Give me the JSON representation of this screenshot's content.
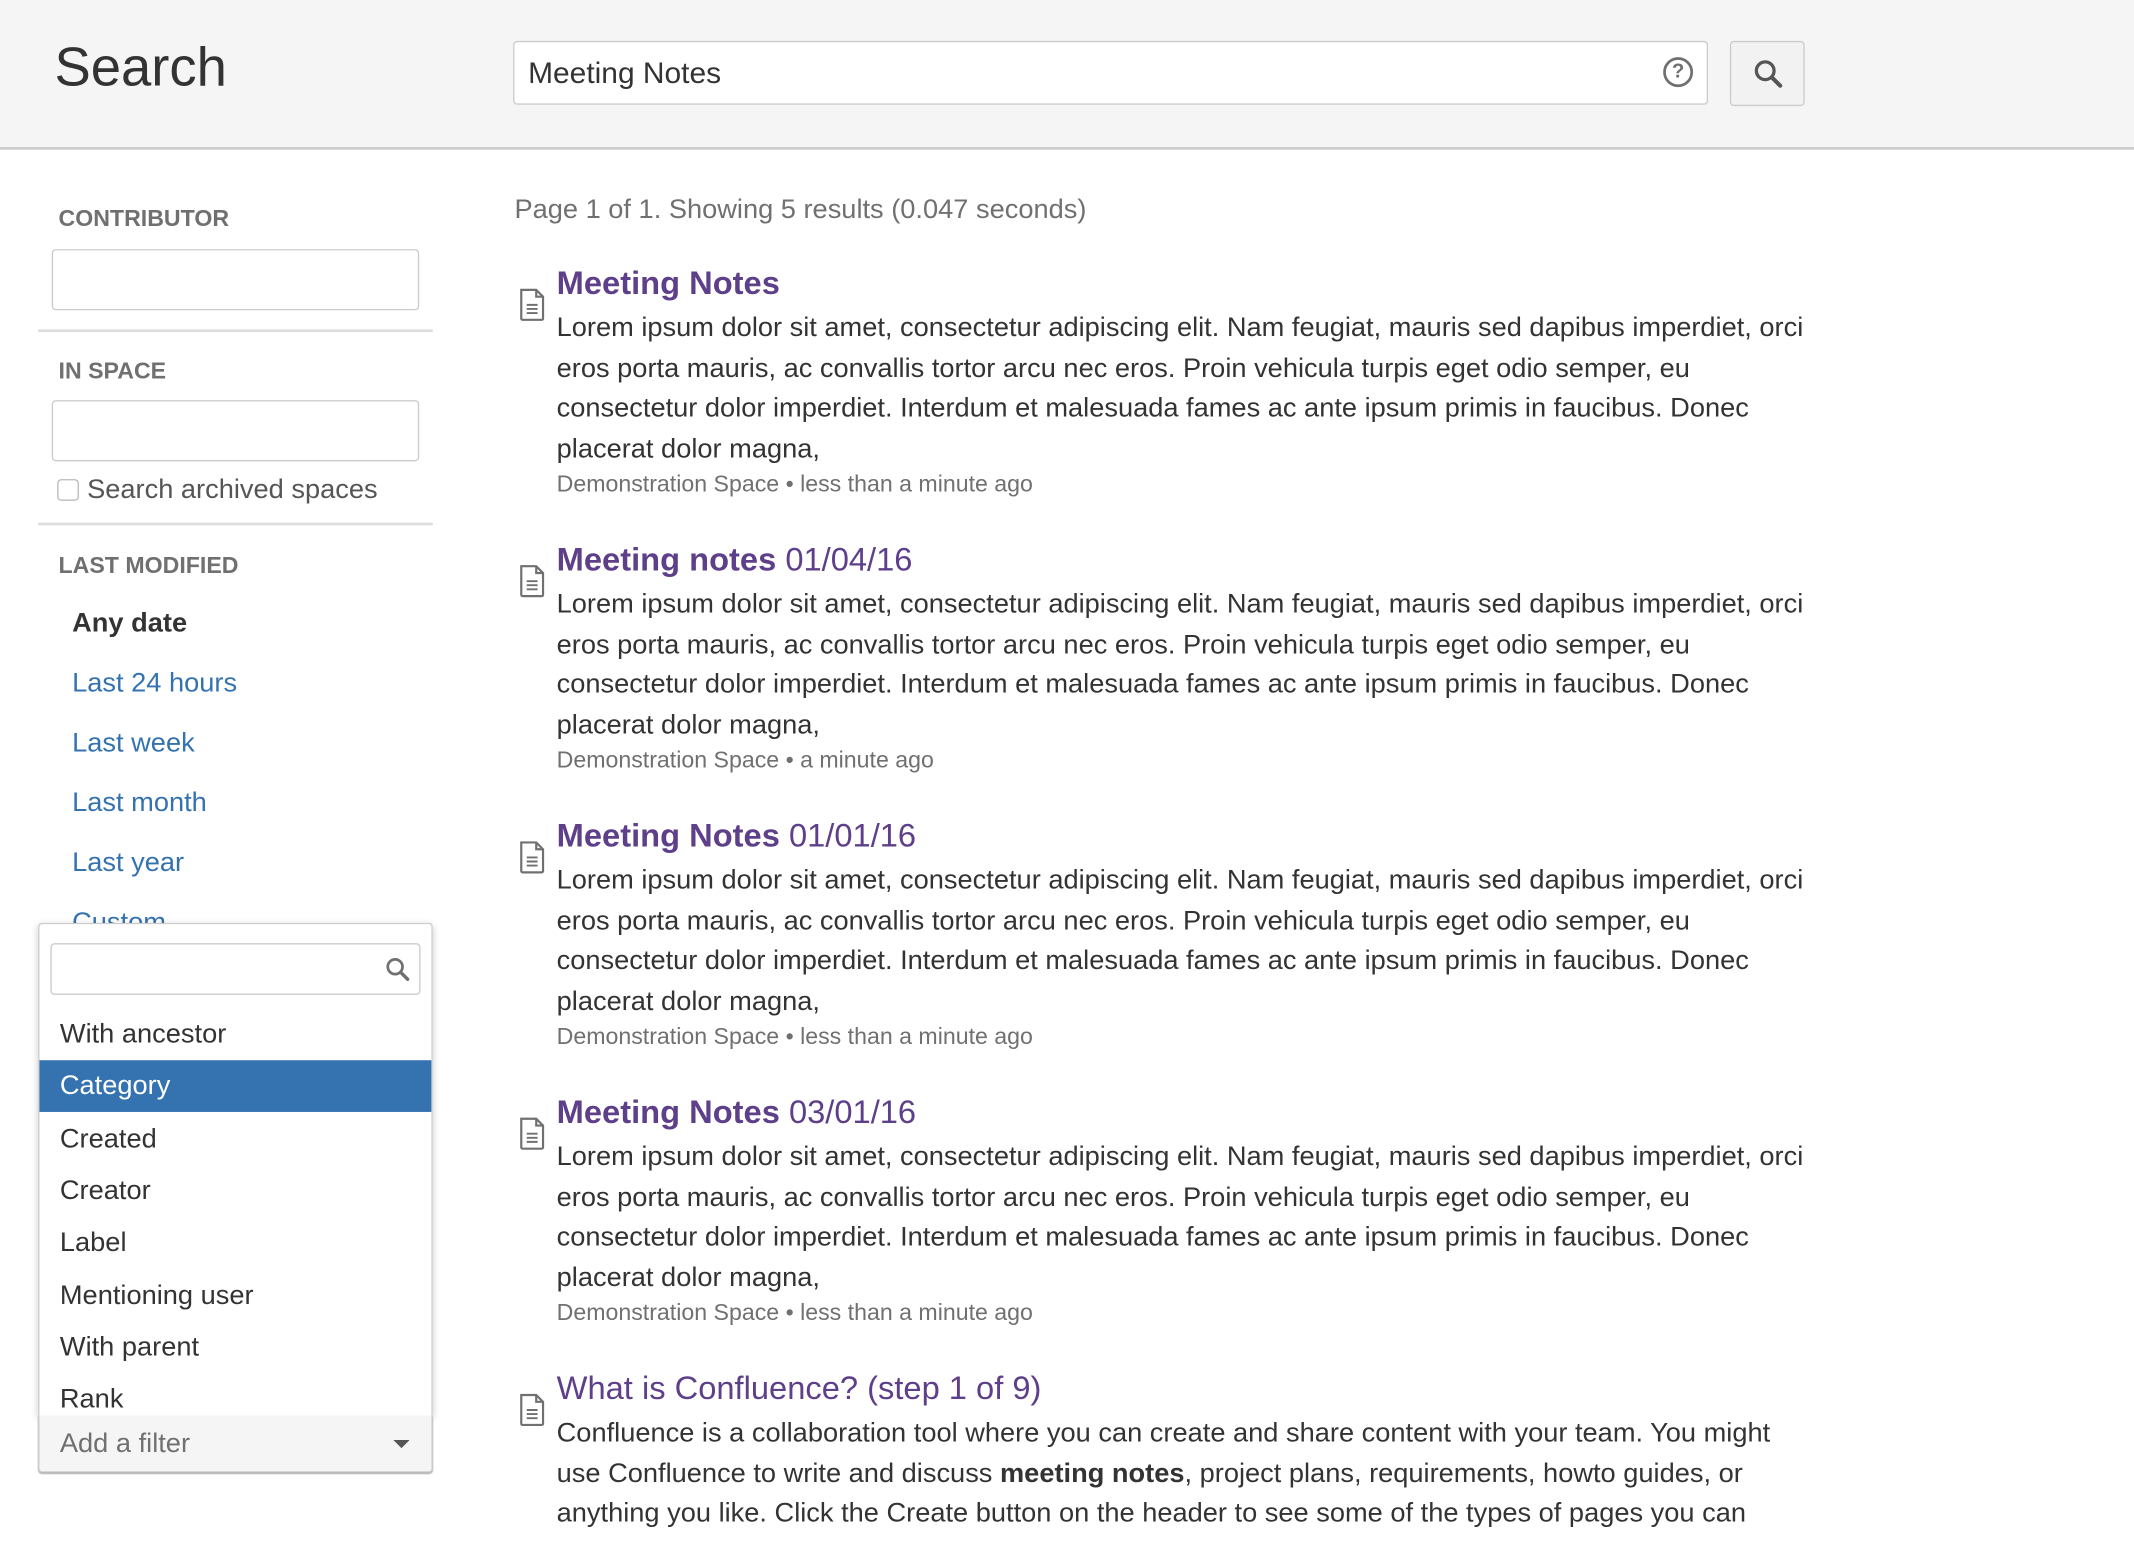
{
  "header": {
    "title": "Search",
    "query": "Meeting Notes",
    "help_icon": "question-circle-icon",
    "search_icon": "magnifier-icon"
  },
  "sidebar": {
    "contributor_label": "CONTRIBUTOR",
    "contributor_value": "",
    "space_label": "IN SPACE",
    "space_value": "",
    "archived_label": "Search archived spaces",
    "archived_checked": false,
    "modified_label": "LAST MODIFIED",
    "date_options": [
      {
        "label": "Any date",
        "selected": true
      },
      {
        "label": "Last 24 hours"
      },
      {
        "label": "Last week"
      },
      {
        "label": "Last month"
      },
      {
        "label": "Last year"
      },
      {
        "label": "Custom"
      }
    ],
    "filter_dropdown": {
      "search_value": "",
      "options": [
        "With ancestor",
        "Category",
        "Created",
        "Creator",
        "Label",
        "Mentioning user",
        "With parent",
        "Rank"
      ],
      "highlighted": "Category"
    },
    "add_filter_label": "Add a filter"
  },
  "colors": {
    "link": "#3572b0",
    "title": "#5e3f8a",
    "highlight": "#3572b0"
  },
  "main": {
    "summary": "Page 1 of 1. Showing 5 results (0.047 seconds)",
    "results": [
      {
        "title_bold": "Meeting Notes",
        "title_rest": "",
        "body": "Lorem ipsum dolor sit amet, consectetur adipiscing elit. Nam feugiat, mauris sed dapibus imperdiet, orci eros porta mauris, ac convallis tortor arcu nec eros. Proin vehicula turpis eget odio semper, eu consectetur dolor imperdiet. Interdum et malesuada fames ac ante ipsum primis in faucibus. Donec placerat dolor magna,",
        "meta": "Demonstration Space • less than a minute ago"
      },
      {
        "title_bold": "Meeting notes",
        "title_rest": " 01/04/16",
        "body": "Lorem ipsum dolor sit amet, consectetur adipiscing elit. Nam feugiat, mauris sed dapibus imperdiet, orci eros porta mauris, ac convallis tortor arcu nec eros. Proin vehicula turpis eget odio semper, eu consectetur dolor imperdiet. Interdum et malesuada fames ac ante ipsum primis in faucibus. Donec placerat dolor magna,",
        "meta": "Demonstration Space • a minute ago"
      },
      {
        "title_bold": "Meeting Notes",
        "title_rest": " 01/01/16",
        "body": "Lorem ipsum dolor sit amet, consectetur adipiscing elit. Nam feugiat, mauris sed dapibus imperdiet, orci eros porta mauris, ac convallis tortor arcu nec eros. Proin vehicula turpis eget odio semper, eu consectetur dolor imperdiet. Interdum et malesuada fames ac ante ipsum primis in faucibus. Donec placerat dolor magna,",
        "meta": "Demonstration Space • less than a minute ago"
      },
      {
        "title_bold": "Meeting Notes",
        "title_rest": " 03/01/16",
        "body": "Lorem ipsum dolor sit amet, consectetur adipiscing elit. Nam feugiat, mauris sed dapibus imperdiet, orci eros porta mauris, ac convallis tortor arcu nec eros. Proin vehicula turpis eget odio semper, eu consectetur dolor imperdiet. Interdum et malesuada fames ac ante ipsum primis in faucibus. Donec placerat dolor magna,",
        "meta": "Demonstration Space • less than a minute ago"
      },
      {
        "title_bold": "",
        "title_rest": "What is Confluence? (step 1 of 9)",
        "body_pre": "Confluence is a collaboration tool where you can create and share content with your team. You might use Confluence to write and discuss ",
        "body_bold": "meeting notes",
        "body_post": ", project plans, requirements, howto guides, or anything you like. Click the Create button on the header to see some of the types of pages you can",
        "meta": ""
      }
    ]
  }
}
